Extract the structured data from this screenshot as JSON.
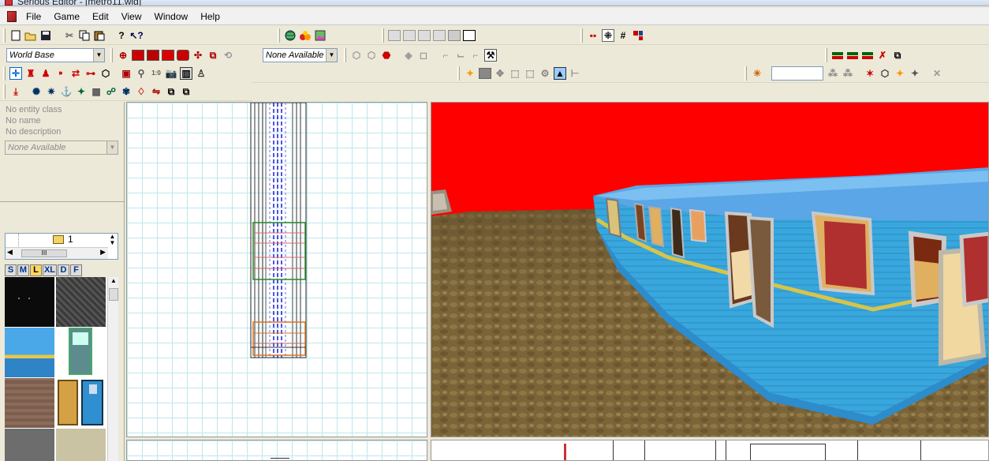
{
  "window": {
    "title": "Serious Editor - [metro11.wld]"
  },
  "menu": [
    "File",
    "Game",
    "Edit",
    "View",
    "Window",
    "Help"
  ],
  "toolbars": {
    "world_base_combo": "World Base",
    "none_available_combo": "None Available"
  },
  "entity_panel": {
    "entity_class": "No entity class",
    "name": "No name",
    "description": "No description",
    "property_combo": "None Available"
  },
  "browser": {
    "folder_number": "1",
    "size_tabs": [
      "S",
      "M",
      "L",
      "XL",
      "D",
      "F"
    ],
    "active_size_tab": "L"
  },
  "colors": {
    "sky": "#ff0000",
    "train_body": "#38a7dd",
    "ground": "#7a6438",
    "grid_line": "#bde7ec"
  },
  "icons": [
    "new-icon",
    "open-icon",
    "save-icon",
    "cut-icon",
    "copy-icon",
    "paste-icon",
    "help-icon",
    "context-help-icon",
    "globe-icon",
    "render-icon",
    "image-icon"
  ]
}
